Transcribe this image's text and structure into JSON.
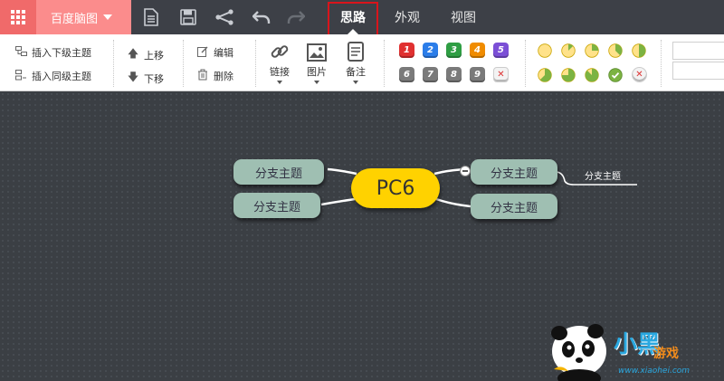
{
  "app": {
    "menu_label": "百度脑图"
  },
  "toolbar": {
    "icons": [
      "new-doc-icon",
      "save-icon",
      "share-icon",
      "undo-icon",
      "redo-icon"
    ]
  },
  "tabs": [
    {
      "label": "思路",
      "active": true
    },
    {
      "label": "外观",
      "active": false
    },
    {
      "label": "视图",
      "active": false
    }
  ],
  "ribbon": {
    "insert_child": "插入下级主题",
    "insert_sibling": "插入同级主题",
    "move_up": "上移",
    "move_down": "下移",
    "edit": "编辑",
    "delete": "删除",
    "link": "链接",
    "image": "图片",
    "note": "备注",
    "priorities": [
      "1",
      "2",
      "3",
      "4",
      "5",
      "6",
      "7",
      "8",
      "9"
    ],
    "priority_colors": [
      "#e03131",
      "#2b7de9",
      "#2f9e44",
      "#f08c00",
      "#7b4fd6",
      "#7a7a7a",
      "#7a7a7a",
      "#7a7a7a",
      "#7a7a7a"
    ],
    "progress": [
      0,
      0.125,
      0.25,
      0.375,
      0.5,
      0.625,
      0.75,
      0.875,
      1
    ],
    "progress_colors": {
      "fill": "#ffe28a",
      "done": "#7cb342"
    }
  },
  "canvas": {
    "center_topic": "PC6",
    "branches_left": [
      "分支主题",
      "分支主题"
    ],
    "branches_right": [
      "分支主题",
      "分支主题"
    ],
    "sub_branch": "分支主题"
  },
  "watermark": {
    "text": "小黑",
    "text2": "游戏",
    "url": "www.xiaohei.com"
  },
  "colors": {
    "topbar": "#3d4047",
    "accent": "#f06a6a",
    "center": "#ffd200",
    "branch": "#9fbfb2",
    "canvas": "#3b3f44",
    "highlight": "#d9141b"
  }
}
